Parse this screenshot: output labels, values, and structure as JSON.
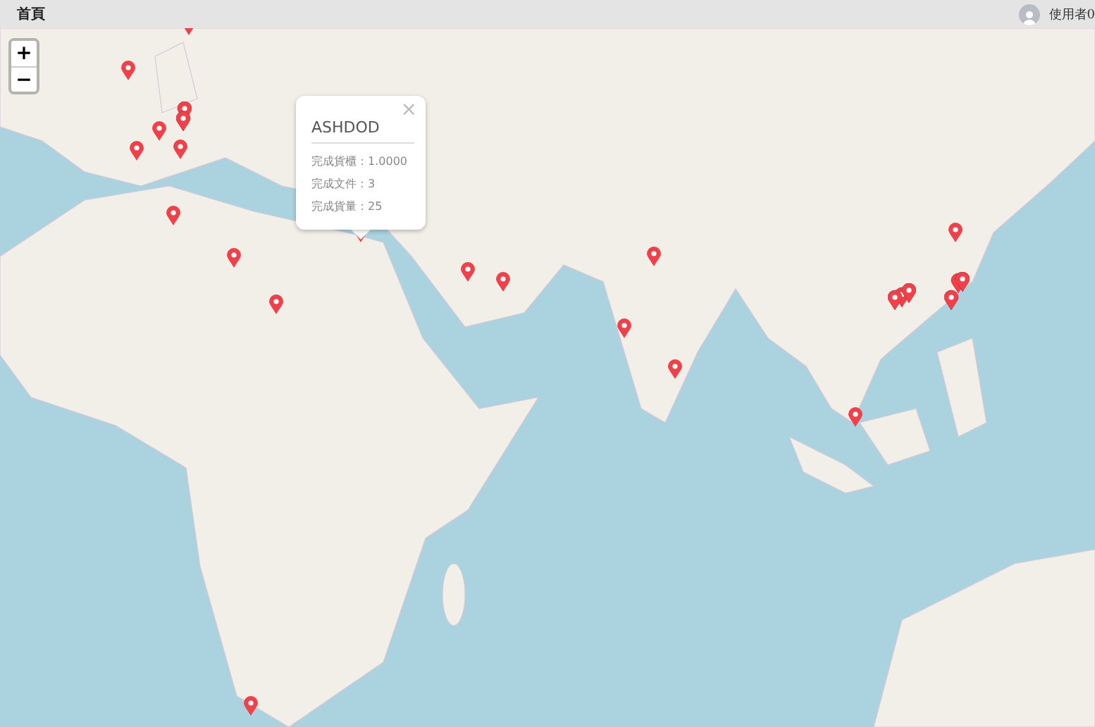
{
  "header": {
    "title": "首頁",
    "user": "使用者0"
  },
  "zoom": {
    "zoom_in": "+",
    "zoom_out": "−"
  },
  "popup": {
    "close": "×",
    "title": "ASHDOD",
    "lines": [
      "完成貨櫃：1.0000",
      "完成文件：3",
      "完成貨量：25"
    ]
  }
}
